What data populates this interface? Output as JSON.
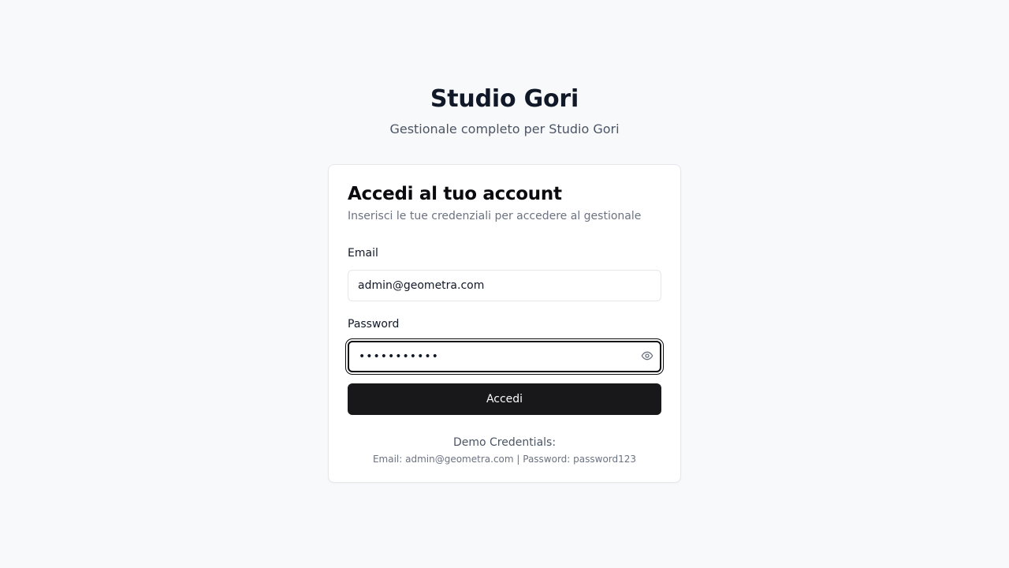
{
  "brand": {
    "title": "Studio Gori",
    "subtitle": "Gestionale completo per Studio Gori"
  },
  "login": {
    "title": "Accedi al tuo account",
    "description": "Inserisci le tue credenziali per accedere al gestionale",
    "email": {
      "label": "Email",
      "value": "admin@geometra.com"
    },
    "password": {
      "label": "Password",
      "value": "password123",
      "toggle_icon": "eye-icon"
    },
    "submit_label": "Accedi"
  },
  "demo": {
    "title": "Demo Credentials:",
    "info": "Email: admin@geometra.com | Password: password123"
  },
  "colors": {
    "background": "#f8f9fb",
    "primary_button": "#18181b",
    "focus_ring": "#0b0b0f"
  }
}
